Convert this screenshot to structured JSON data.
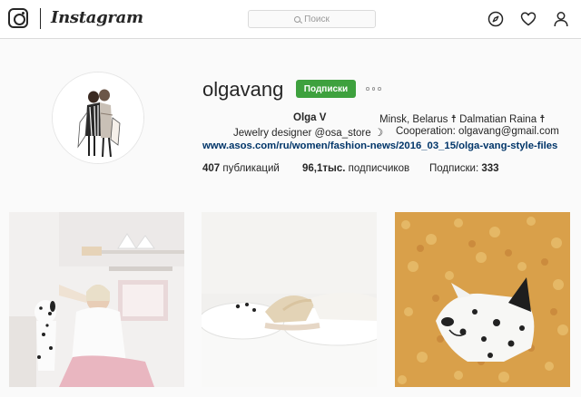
{
  "header": {
    "logo_wordmark": "Instagram",
    "search_placeholder": "Поиск"
  },
  "profile": {
    "username": "olgavang",
    "follow_label": "Подписки",
    "full_name": "Olga V",
    "bio_location": "Minsk, Belarus ☨ Dalmatian Raina ☨",
    "bio_job": "Jewelry designer @osa_store ☽",
    "bio_coop": "Cooperation: olgavang@gmail.com",
    "website": "www.asos.com/ru/women/fashion-news/2016_03_15/olga-vang-style-files"
  },
  "stats": {
    "posts_count": "407",
    "posts_label": "публикаций",
    "followers_count": "96,1тыс.",
    "followers_label": "подписчиков",
    "following_label": "Подписки:",
    "following_count": "333"
  },
  "colors": {
    "accent": "#3ea13e",
    "link": "#003569",
    "background": "#fafafa"
  },
  "icons": [
    "instagram-camera-icon",
    "search-icon",
    "compass-icon",
    "heart-icon",
    "user-icon",
    "more-options-icon"
  ]
}
